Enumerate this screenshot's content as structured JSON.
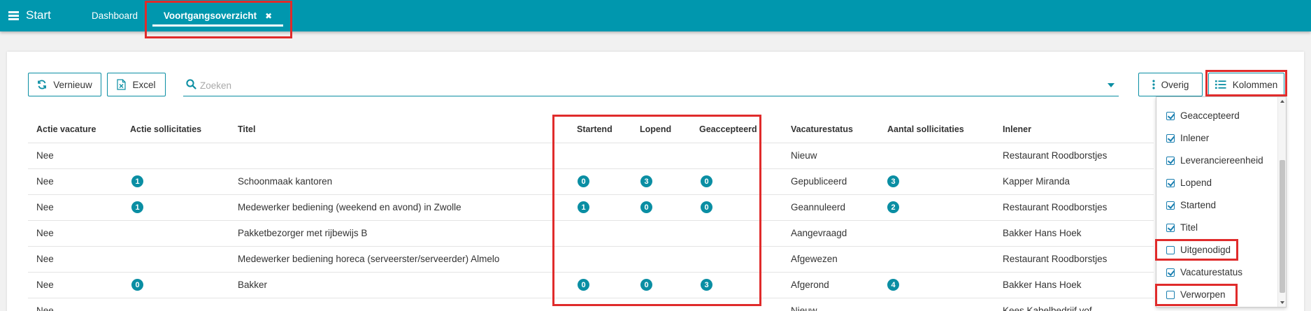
{
  "topbar": {
    "start_label": "Start",
    "tabs": [
      {
        "label": "Dashboard"
      },
      {
        "label": "Voortgangsoverzicht",
        "close": "✖"
      }
    ]
  },
  "toolbar": {
    "refresh_label": "Vernieuw",
    "excel_label": "Excel",
    "search_placeholder": "Zoeken",
    "other_label": "Overig",
    "columns_label": "Kolommen"
  },
  "table": {
    "headers": {
      "actie_vacature": "Actie vacature",
      "actie_sollicitaties": "Actie sollicitaties",
      "titel": "Titel",
      "startend": "Startend",
      "lopend": "Lopend",
      "geaccepteerd": "Geaccepteerd",
      "vacaturestatus": "Vacaturestatus",
      "aantal_sollicitaties": "Aantal sollicitaties",
      "inlener": "Inlener"
    },
    "rows": [
      {
        "actie_vacature": "Nee",
        "actie_sollicitaties": "",
        "titel": "",
        "startend": "",
        "lopend": "",
        "geaccepteerd": "",
        "vacaturestatus": "Nieuw",
        "aantal_sollicitaties": "",
        "inlener": "Restaurant Roodborstjes"
      },
      {
        "actie_vacature": "Nee",
        "actie_sollicitaties": "1",
        "titel": "Schoonmaak kantoren",
        "startend": "0",
        "lopend": "3",
        "geaccepteerd": "0",
        "vacaturestatus": "Gepubliceerd",
        "aantal_sollicitaties": "3",
        "inlener": "Kapper Miranda"
      },
      {
        "actie_vacature": "Nee",
        "actie_sollicitaties": "1",
        "titel": "Medewerker bediening (weekend en avond) in Zwolle",
        "startend": "1",
        "lopend": "0",
        "geaccepteerd": "0",
        "vacaturestatus": "Geannuleerd",
        "aantal_sollicitaties": "2",
        "inlener": "Restaurant Roodborstjes"
      },
      {
        "actie_vacature": "Nee",
        "actie_sollicitaties": "",
        "titel": "Pakketbezorger met rijbewijs B",
        "startend": "",
        "lopend": "",
        "geaccepteerd": "",
        "vacaturestatus": "Aangevraagd",
        "aantal_sollicitaties": "",
        "inlener": "Bakker Hans Hoek"
      },
      {
        "actie_vacature": "Nee",
        "actie_sollicitaties": "",
        "titel": "Medewerker bediening horeca (serveerster/serveerder) Almelo",
        "startend": "",
        "lopend": "",
        "geaccepteerd": "",
        "vacaturestatus": "Afgewezen",
        "aantal_sollicitaties": "",
        "inlener": "Restaurant Roodborstjes"
      },
      {
        "actie_vacature": "Nee",
        "actie_sollicitaties": "0",
        "titel": "Bakker",
        "startend": "0",
        "lopend": "0",
        "geaccepteerd": "3",
        "vacaturestatus": "Afgerond",
        "aantal_sollicitaties": "4",
        "inlener": "Bakker Hans Hoek"
      },
      {
        "actie_vacature": "Nee",
        "actie_sollicitaties": "",
        "titel": "",
        "startend": "",
        "lopend": "",
        "geaccepteerd": "",
        "vacaturestatus": "Nieuw",
        "aantal_sollicitaties": "",
        "inlener": "Kees Kabelbedrijf vof"
      }
    ]
  },
  "columns_menu": {
    "items": [
      {
        "label": "Geaccepteerd",
        "checked": true
      },
      {
        "label": "Inlener",
        "checked": true
      },
      {
        "label": "Leveranciereenheid",
        "checked": true
      },
      {
        "label": "Lopend",
        "checked": true
      },
      {
        "label": "Startend",
        "checked": true
      },
      {
        "label": "Titel",
        "checked": true
      },
      {
        "label": "Uitgenodigd",
        "checked": false
      },
      {
        "label": "Vacaturestatus",
        "checked": true
      },
      {
        "label": "Verworpen",
        "checked": false
      }
    ]
  },
  "colors": {
    "topbar": "#0097ae",
    "accent": "#0a8ea3",
    "highlight": "#e02b2b"
  }
}
